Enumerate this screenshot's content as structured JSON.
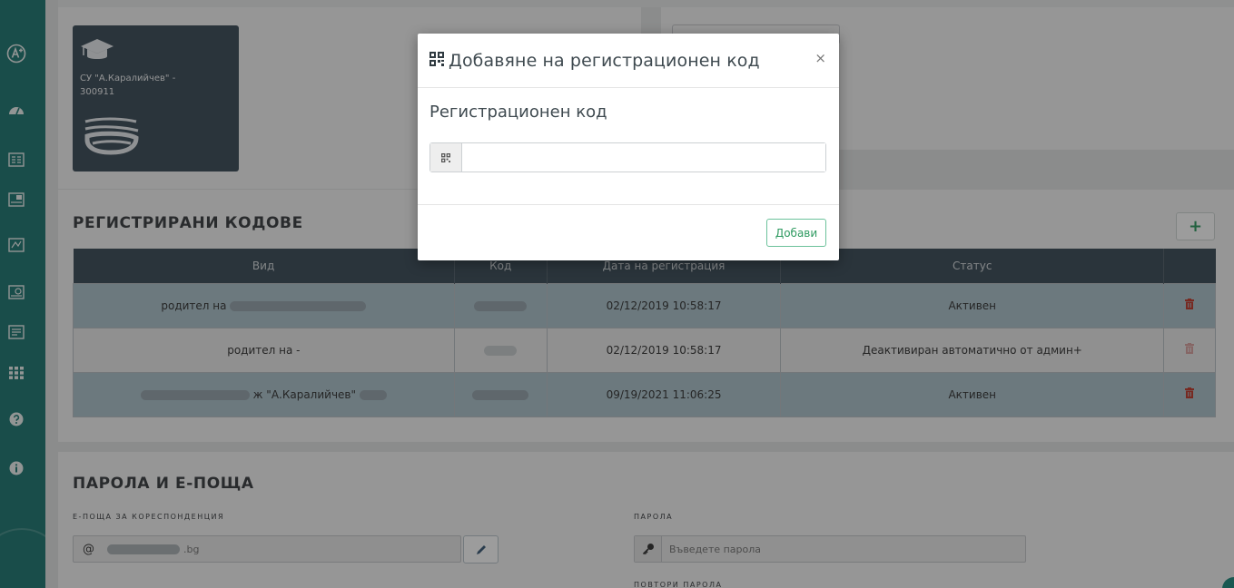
{
  "sidebar": {
    "icons": [
      "a-plus-logo-icon",
      "dashboard-gauge-icon",
      "grades-card-icon",
      "schedule-card-icon",
      "absences-card-icon",
      "remarks-card-icon",
      "reports-card-icon",
      "apps-grid-icon",
      "help-icon",
      "info-icon"
    ]
  },
  "school_card": {
    "name": "СУ \"А.Каралийчев\" -",
    "code": "300911"
  },
  "codes_section": {
    "title": "РЕГИСТРИРАНИ КОДОВЕ",
    "add_label": "+",
    "columns": [
      "Вид",
      "Код",
      "Дата на регистрация",
      "Статус",
      ""
    ],
    "rows": [
      {
        "kind": "родител на",
        "date": "02/12/2019 10:58:17",
        "status": "Активен",
        "style": "alt",
        "trash_color": "#c0392b"
      },
      {
        "kind": "родител на -",
        "date": "02/12/2019 10:58:17",
        "status": "Деактивиран автоматично от админ+",
        "style": "plain",
        "trash_color": "#d9a3a0"
      },
      {
        "kind": "ж \"А.Каралийчев\"",
        "date": "09/19/2021 11:06:25",
        "status": "Активен",
        "style": "alt",
        "trash_color": "#c0392b"
      }
    ]
  },
  "password_section": {
    "title": "ПАРОЛА И Е-ПОЩА",
    "email_label": "Е-ПОЩА ЗА КОРЕСПОНДЕНЦИЯ",
    "email_prefix": "@",
    "email_value": ".bg",
    "password_label": "ПАРОЛА",
    "password_placeholder": "Въведете парола",
    "repeat_label": "ПОВТОРИ ПАРОЛА"
  },
  "modal": {
    "title": "Добавяне на регистрационен код",
    "close_label": "×",
    "field_label": "Регистрационен код",
    "input_value": "",
    "submit_label": "Добави"
  }
}
